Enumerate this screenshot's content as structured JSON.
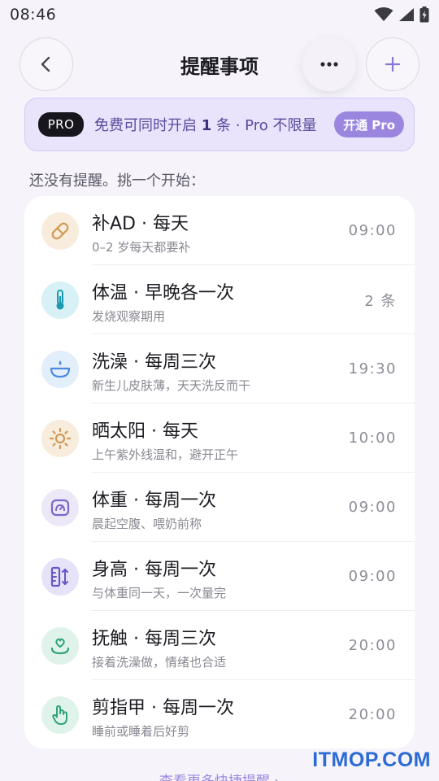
{
  "status_bar": {
    "time": "08:46"
  },
  "header": {
    "title": "提醒事项"
  },
  "pro_banner": {
    "badge": "PRO",
    "text_before": "免费可同时开启",
    "count": "1",
    "text_after": "条 · Pro 不限量",
    "button_label": "开通 Pro"
  },
  "hint": "还没有提醒。挑一个开始：",
  "reminders": [
    {
      "title": "补AD · 每天",
      "subtitle": "0–2 岁每天都要补",
      "right": "09:00",
      "icon": "pill-icon",
      "icon_bg": "#f8ecdc",
      "icon_color": "#d09a56"
    },
    {
      "title": "体温 · 早晚各一次",
      "subtitle": "发烧观察期用",
      "right": "2 条",
      "icon": "thermometer-icon",
      "icon_bg": "#d7f1f6",
      "icon_color": "#1a9bb2"
    },
    {
      "title": "洗澡 · 每周三次",
      "subtitle": "新生儿皮肤薄，天天洗反而干",
      "right": "19:30",
      "icon": "bathtub-icon",
      "icon_bg": "#e3eefb",
      "icon_color": "#4a8be0"
    },
    {
      "title": "晒太阳 · 每天",
      "subtitle": "上午紫外线温和，避开正午",
      "right": "10:00",
      "icon": "sun-icon",
      "icon_bg": "#f8ecdc",
      "icon_color": "#d09a56"
    },
    {
      "title": "体重 · 每周一次",
      "subtitle": "晨起空腹、喂奶前称",
      "right": "09:00",
      "icon": "scale-icon",
      "icon_bg": "#ece8f8",
      "icon_color": "#7b68c8"
    },
    {
      "title": "身高 · 每周一次",
      "subtitle": "与体重同一天，一次量完",
      "right": "09:00",
      "icon": "ruler-icon",
      "icon_bg": "#e6e2f8",
      "icon_color": "#6a55c8"
    },
    {
      "title": "抚触 · 每周三次",
      "subtitle": "接着洗澡做，情绪也合适",
      "right": "20:00",
      "icon": "heart-hand-icon",
      "icon_bg": "#dff3ea",
      "icon_color": "#2fa37a"
    },
    {
      "title": "剪指甲 · 每周一次",
      "subtitle": "睡前或睡着后好剪",
      "right": "20:00",
      "icon": "hand-icon",
      "icon_bg": "#dff3ea",
      "icon_color": "#2fa37a"
    }
  ],
  "more_link": "查看更多快捷提醒 ›",
  "watermark": "ITMOP.COM"
}
